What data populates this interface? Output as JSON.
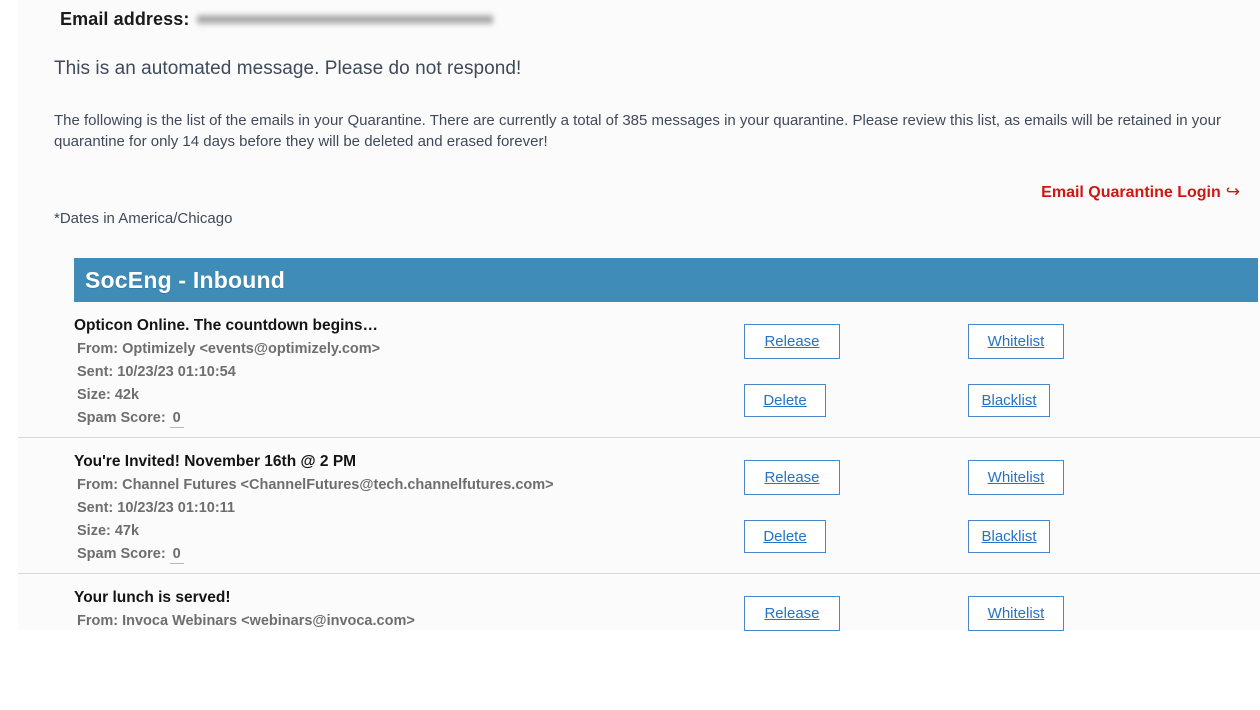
{
  "header": {
    "email_address_label": "Email address:",
    "email_address_value_redacted": true,
    "automated_message": "This is an automated message. Please do not respond!",
    "intro_paragraph": "The following is the list of the emails in your Quarantine. There are currently a total of 385 messages in your quarantine. Please review this list, as emails will be retained in your quarantine for only 14 days before they will be deleted and erased forever!",
    "total_messages": 385,
    "retention_days": 14,
    "login_link_label": "Email Quarantine Login",
    "login_link_arrow": "↪",
    "dates_note": "*Dates in America/Chicago"
  },
  "section": {
    "title": "SocEng - Inbound",
    "bar_color": "#3f8cb8",
    "title_color": "#ffffff"
  },
  "labels": {
    "from": "From:",
    "sent": "Sent:",
    "size": "Size:",
    "spam_score": "Spam Score:"
  },
  "actions": {
    "release": "Release",
    "delete": "Delete",
    "whitelist": "Whitelist",
    "blacklist": "Blacklist",
    "link_color": "#2672c4",
    "border_color": "#4a87c9"
  },
  "messages": [
    {
      "subject": "Opticon Online. The countdown begins…",
      "from": "From: Optimizely <events@optimizely.com>",
      "sent": "Sent: 10/23/23 01:10:54",
      "size": "Size: 42k",
      "spam_score_label": "Spam Score:",
      "spam_score": "0"
    },
    {
      "subject": "You're Invited! November 16th @ 2 PM",
      "from": "From: Channel Futures <ChannelFutures@tech.channelfutures.com>",
      "sent": "Sent: 10/23/23 01:10:11",
      "size": "Size: 47k",
      "spam_score_label": "Spam Score:",
      "spam_score": "0"
    },
    {
      "subject": "Your lunch is served!",
      "from": "From: Invoca Webinars <webinars@invoca.com>",
      "sent": "",
      "size": "",
      "spam_score_label": "",
      "spam_score": ""
    }
  ]
}
